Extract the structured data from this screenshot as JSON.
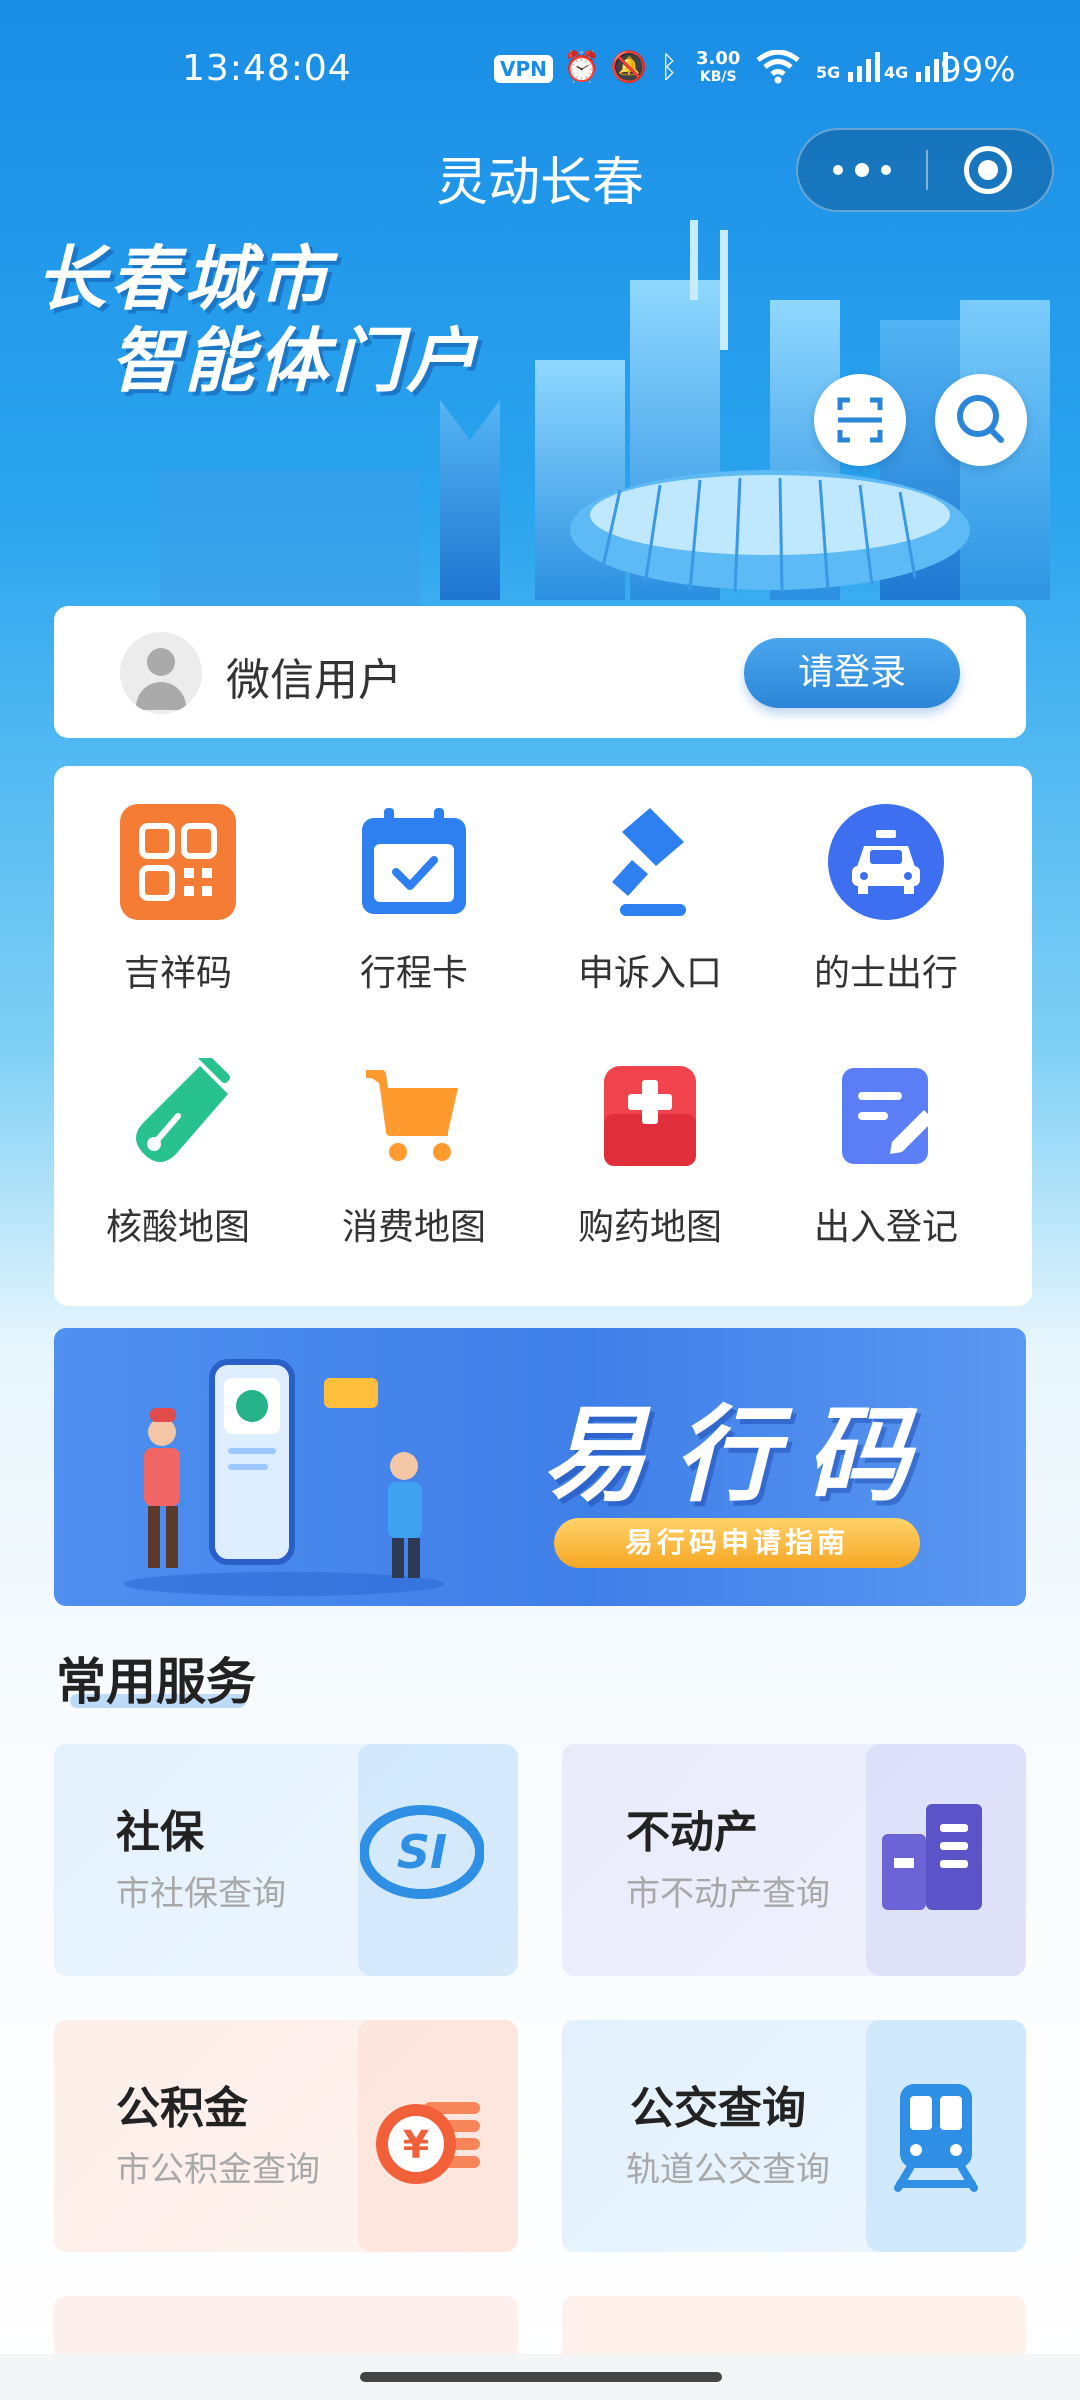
{
  "status_bar": {
    "time": "13:48:04",
    "vpn": "VPN",
    "speed_value": "3.00",
    "speed_unit": "KB/S",
    "net1": "5G",
    "net2": "4G",
    "battery": "99%"
  },
  "header": {
    "title": "灵动长春"
  },
  "hero": {
    "line1": "长春城市",
    "line2": "智能体门户"
  },
  "user": {
    "name": "微信用户",
    "login_label": "请登录"
  },
  "grid": {
    "items": [
      {
        "label": "吉祥码",
        "icon": "qr-code-icon"
      },
      {
        "label": "行程卡",
        "icon": "calendar-check-icon"
      },
      {
        "label": "申诉入口",
        "icon": "gavel-icon"
      },
      {
        "label": "的士出行",
        "icon": "taxi-icon"
      },
      {
        "label": "核酸地图",
        "icon": "test-tube-icon"
      },
      {
        "label": "消费地图",
        "icon": "shopping-cart-icon"
      },
      {
        "label": "购药地图",
        "icon": "medicine-box-icon"
      },
      {
        "label": "出入登记",
        "icon": "edit-form-icon"
      }
    ]
  },
  "banner": {
    "title": "易行码",
    "subtitle": "易行码申请指南"
  },
  "services": {
    "section_title": "常用服务",
    "items": [
      {
        "title": "社保",
        "subtitle": "市社保查询",
        "icon": "social-security-icon"
      },
      {
        "title": "不动产",
        "subtitle": "市不动产查询",
        "icon": "building-icon"
      },
      {
        "title": "公积金",
        "subtitle": "市公积金查询",
        "icon": "coin-stack-icon"
      },
      {
        "title": "公交查询",
        "subtitle": "轨道公交查询",
        "icon": "train-icon"
      }
    ]
  },
  "colors": {
    "primary": "#2b86d9",
    "orange": "#f47c35",
    "blue_icon": "#2e7ff0"
  }
}
